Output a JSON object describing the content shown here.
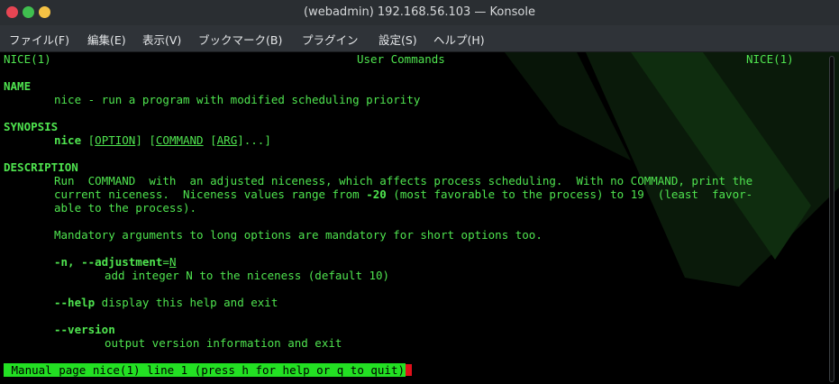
{
  "window": {
    "title": "(webadmin) 192.168.56.103 — Konsole"
  },
  "menu": [
    "ファイル(F)",
    "編集(E)",
    "表示(V)",
    "ブックマーク(B)",
    "プラグイン",
    "設定(S)",
    "ヘルプ(H)"
  ],
  "colors": {
    "text": "#4fe44f",
    "status_bg": "#23e023",
    "cursor": "#e0101a",
    "close": "#e64553",
    "minimize": "#f5c244",
    "maximize": "#3fbf4f"
  },
  "man": {
    "header_left": "NICE(1)",
    "header_center": "User Commands",
    "header_right": "NICE(1)",
    "name_heading": "NAME",
    "name_text": "nice - run a program with modified scheduling priority",
    "synopsis_heading": "SYNOPSIS",
    "synopsis_cmd": "nice",
    "synopsis_option": "OPTION",
    "synopsis_command": "COMMAND",
    "synopsis_arg": "ARG",
    "description_heading": "DESCRIPTION",
    "desc_line1": "Run  COMMAND  with  an adjusted niceness, which affects process scheduling.  With no COMMAND, print the",
    "desc_line2a": "current niceness.  Niceness values range from ",
    "desc_line2b": "-20",
    "desc_line2c": " (most favorable to the process) to 19  (least  favor-",
    "desc_line3": "able to the process).",
    "mandatory": "Mandatory arguments to long options are mandatory for short options too.",
    "opt_n": "-n, --adjustment",
    "opt_n_arg": "N",
    "opt_n_desc": "add integer N to the niceness (default 10)",
    "opt_help": "--help",
    "opt_help_desc": " display this help and exit",
    "opt_version": "--version",
    "opt_version_desc": "output version information and exit",
    "status_line": " Manual page nice(1) line 1 (press h for help or q to quit)"
  }
}
